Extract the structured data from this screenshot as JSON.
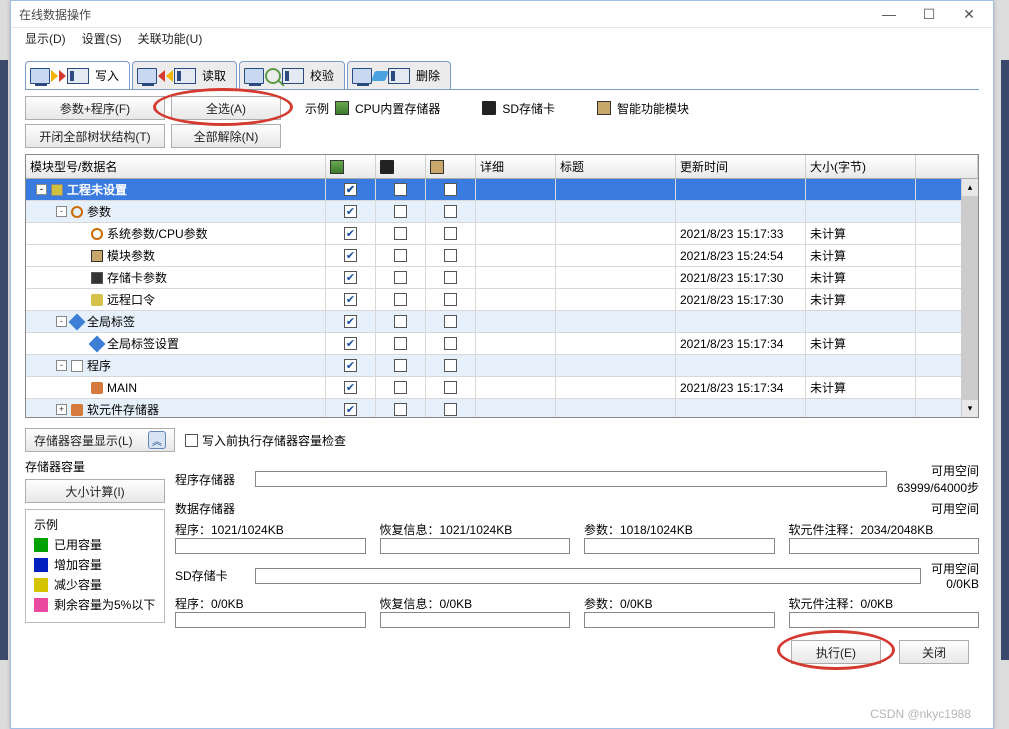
{
  "window": {
    "title": "在线数据操作"
  },
  "menu": {
    "display": "显示(D)",
    "settings": "设置(S)",
    "assoc": "关联功能(U)"
  },
  "tabs": {
    "write": "写入",
    "read": "读取",
    "verify": "校验",
    "delete": "删除"
  },
  "buttons": {
    "params_program": "参数+程序(F)",
    "select_all": "全选(A)",
    "expand_tree": "开闭全部树状结构(T)",
    "clear_all": "全部解除(N)",
    "storage_display": "存储器容量显示(L)",
    "calc_size": "大小计算(I)",
    "execute": "执行(E)",
    "close": "关闭"
  },
  "legend_bar": {
    "example": "示例",
    "cpu": "CPU内置存储器",
    "sd": "SD存储卡",
    "fn": "智能功能模块"
  },
  "check": {
    "pre_check": "写入前执行存储器容量检查"
  },
  "table": {
    "headers": {
      "name": "模块型号/数据名",
      "c1": "",
      "c2": "",
      "c3": "",
      "detail": "详细",
      "title": "标题",
      "updated": "更新时间",
      "size": "大小(字节)"
    },
    "rows": [
      {
        "lvl": 1,
        "sel": true,
        "tog": "-",
        "icon": "proj",
        "name": "工程未设置",
        "cb": [
          1,
          0,
          0
        ]
      },
      {
        "lvl": 2,
        "tog": "-",
        "icon": "gear",
        "name": "参数",
        "cb": [
          1,
          0,
          0
        ]
      },
      {
        "lvl": 3,
        "icon": "gear",
        "name": "系统参数/CPU参数",
        "cb": [
          1,
          0,
          0
        ],
        "time": "2021/8/23 15:17:33",
        "size": "未计算"
      },
      {
        "lvl": 3,
        "icon": "fn-ic",
        "name": "模块参数",
        "cb": [
          1,
          0,
          0
        ],
        "time": "2021/8/23 15:24:54",
        "size": "未计算"
      },
      {
        "lvl": 3,
        "icon": "mem",
        "name": "存储卡参数",
        "cb": [
          1,
          0,
          0
        ],
        "time": "2021/8/23 15:17:30",
        "size": "未计算"
      },
      {
        "lvl": 3,
        "icon": "lock",
        "name": "远程口令",
        "cb": [
          1,
          0,
          0
        ],
        "time": "2021/8/23 15:17:30",
        "size": "未计算"
      },
      {
        "lvl": 2,
        "tog": "-",
        "icon": "tag",
        "name": "全局标签",
        "cb": [
          1,
          0,
          0
        ]
      },
      {
        "lvl": 3,
        "icon": "tag",
        "name": "全局标签设置",
        "cb": [
          1,
          0,
          0
        ],
        "time": "2021/8/23 15:17:34",
        "size": "未计算"
      },
      {
        "lvl": 2,
        "tog": "-",
        "icon": "doc",
        "name": "程序",
        "cb": [
          1,
          0,
          0
        ]
      },
      {
        "lvl": 3,
        "icon": "prg",
        "name": "MAIN",
        "cb": [
          1,
          0,
          0
        ],
        "time": "2021/8/23 15:17:34",
        "size": "未计算"
      },
      {
        "lvl": 2,
        "tog": "+",
        "icon": "dev",
        "name": "软元件存储器",
        "cb": [
          1,
          0,
          0
        ]
      }
    ]
  },
  "capacity": {
    "section": "存储器容量",
    "legend": "示例",
    "used": "已用容量",
    "added": "增加容量",
    "reduced": "减少容量",
    "remain5": "剩余容量为5%以下",
    "prog_mem": "程序存储器",
    "free": "可用空间",
    "prog_free": "63999/64000步",
    "data_mem": "数据存储器",
    "data_free": "",
    "sd_card": "SD存储卡",
    "sd_free": "0/0KB",
    "d1_program_l": "程序：1021/1024KB",
    "d1_restore_l": "恢复信息：1021/1024KB",
    "d1_param_l": "参数：1018/1024KB",
    "d1_comment_l": "软元件注释：2034/2048KB",
    "d2_program_l": "程序：0/0KB",
    "d2_restore_l": "恢复信息：0/0KB",
    "d2_param_l": "参数：0/0KB",
    "d2_comment_l": "软元件注释：0/0KB"
  },
  "watermark": "CSDN @nkyc1988"
}
